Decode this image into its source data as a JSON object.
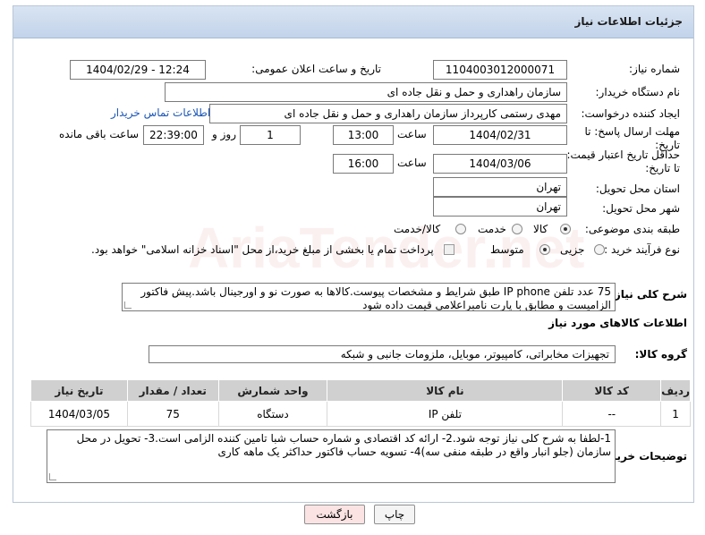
{
  "header": {
    "title": "جزئیات اطلاعات نیاز"
  },
  "fields": {
    "need_number_label": "شماره نیاز:",
    "need_number": "1104003012000071",
    "announce_label": "تاریخ و ساعت اعلان عمومی:",
    "announce_value": "1404/02/29 - 12:24",
    "buyer_org_label": "نام دستگاه خریدار:",
    "buyer_org": "سازمان راهداری و حمل و نقل جاده ای",
    "creator_label": "ایجاد کننده درخواست:",
    "creator": "مهدی رستمی کارپرداز سازمان راهداری و حمل و نقل جاده ای",
    "contact_link": "اطلاعات تماس خریدار",
    "reply_deadline_label": "مهلت ارسال پاسخ: تا تاریخ:",
    "reply_date": "1404/02/31",
    "time_label": "ساعت",
    "reply_time": "13:00",
    "days_value": "1",
    "days_label": "روز و",
    "remaining_time": "22:39:00",
    "remaining_label": "ساعت باقی مانده",
    "validity_label": "حداقل تاریخ اعتبار قیمت: تا تاریخ:",
    "validity_date": "1404/03/06",
    "validity_time": "16:00",
    "province_label": "استان محل تحویل:",
    "province": "تهران",
    "city_label": "شهر محل تحویل:",
    "city": "تهران",
    "category_label": "طبقه بندی موضوعی:",
    "category_options": [
      "کالا",
      "خدمت",
      "کالا/خدمت"
    ],
    "process_label": "نوع فرآیند خرید :",
    "process_options": [
      "جزیی",
      "متوسط"
    ],
    "payment_note": "پرداخت تمام یا بخشی از مبلغ خرید،از محل \"اسناد خزانه اسلامی\" خواهد بود."
  },
  "description": {
    "label": "شرح کلی نیاز:",
    "text": "75 عدد تلفن IP phone طبق شرایط و مشخصات پیوست.کالاها به صورت نو و اورجینال باشد.پیش فاکتور الزامیست و مطابق با پارت نامبراعلامی قیمت داده شود"
  },
  "goods": {
    "section_title": "اطلاعات کالاهای مورد نیاز",
    "group_label": "گروه کالا:",
    "group_value": "تجهیزات مخابراتی، کامپیوتر، موبایل، ملزومات جانبی و شبکه",
    "columns": [
      "ردیف",
      "کد کالا",
      "نام کالا",
      "واحد شمارش",
      "تعداد / مقدار",
      "تاریخ نیاز"
    ],
    "rows": [
      {
        "index": "1",
        "code": "--",
        "name": "تلفن IP",
        "unit": "دستگاه",
        "qty": "75",
        "date": "1404/03/05"
      }
    ]
  },
  "buyer_notes": {
    "label": "توضیحات خریدار:",
    "text": "1-لطفا به شرح کلی نیاز توجه شود.2- ارائه کد اقتصادی و شماره حساب شبا تامین کننده الزامی است.3- تحویل در محل سازمان (جلو انبار واقع در طبقه منفی سه)4- تسویه حساب فاکتور حداکثر یک ماهه کاری"
  },
  "buttons": {
    "print": "چاپ",
    "back": "بازگشت"
  },
  "colors": {
    "header_bg": "#c9d8ec",
    "link": "#1a56b8",
    "back_btn": "#fbe3e3"
  }
}
